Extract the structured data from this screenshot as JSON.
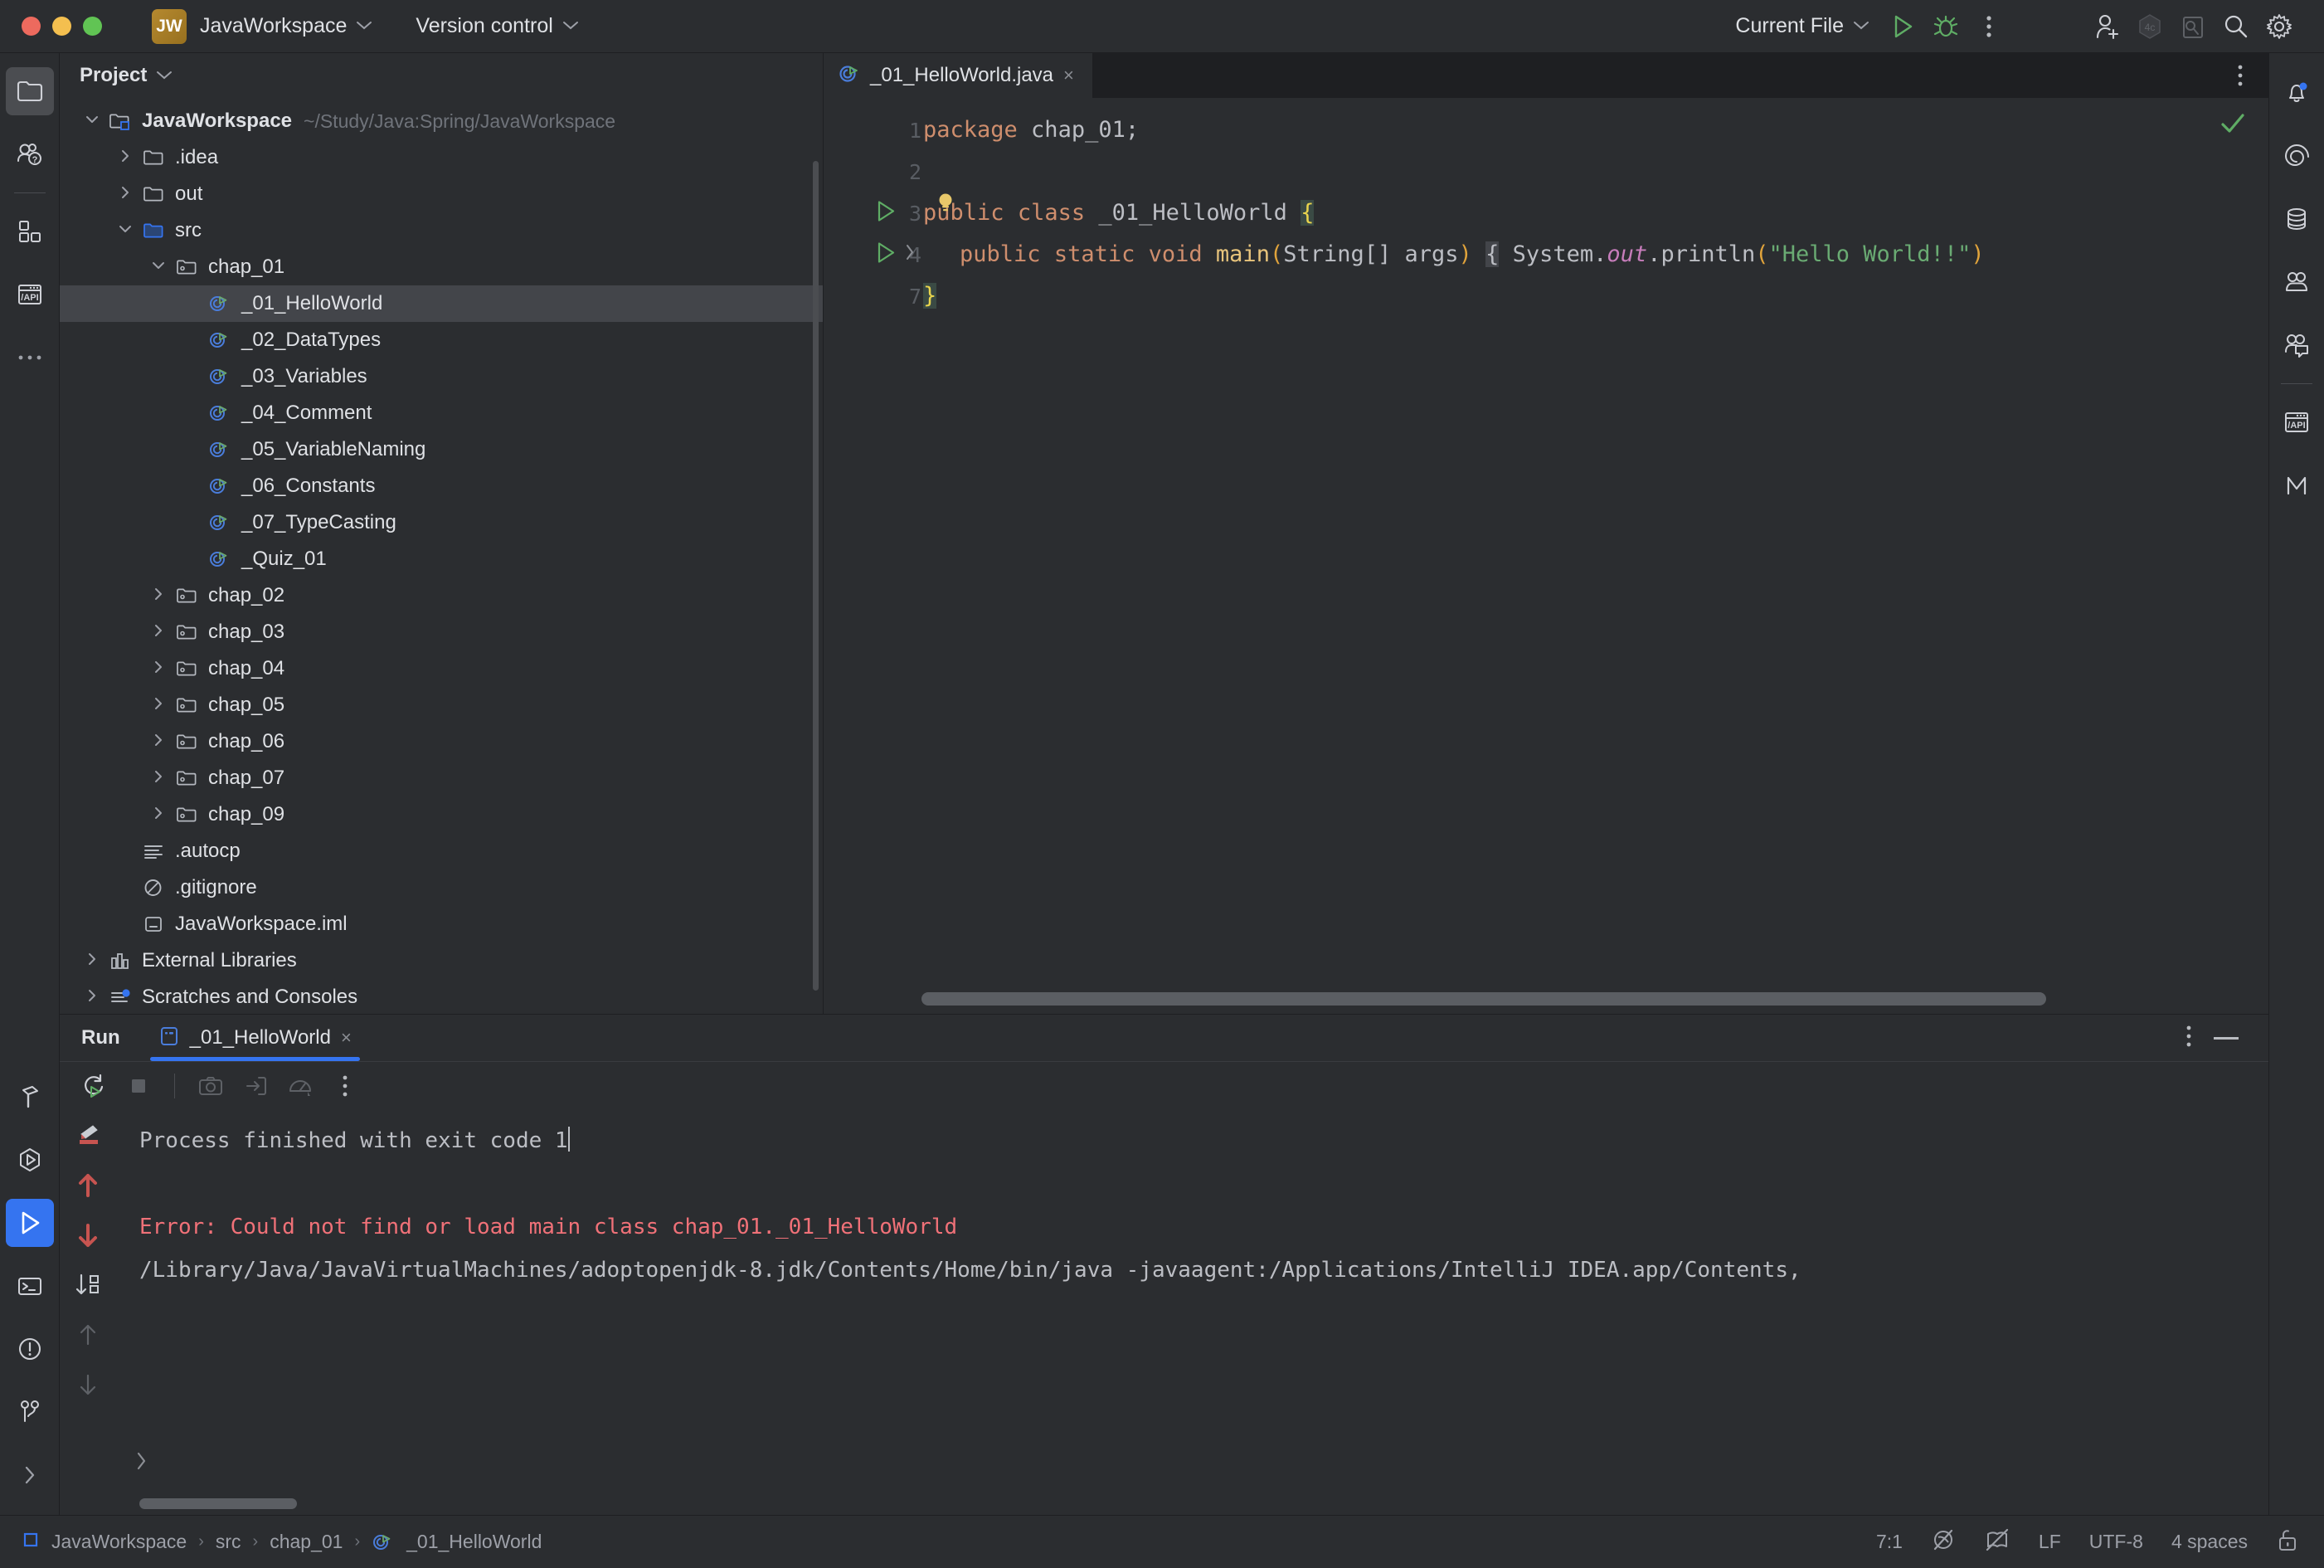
{
  "titlebar": {
    "project_badge": "JW",
    "project_name": "JavaWorkspace",
    "version_control": "Version control",
    "run_config": "Current File",
    "icons": {
      "run": "run-icon",
      "debug": "debug-icon",
      "more": "more-options-icon",
      "add_user": "add-user-icon",
      "code_with_me": "code-with-me-icon",
      "search_everywhere": "search-icon",
      "settings": "settings-icon"
    }
  },
  "left_rail": {
    "top_items": [
      {
        "name": "project-tool-icon",
        "selected": true
      },
      {
        "name": "learn-tool-icon",
        "selected": false
      },
      {
        "name": "plugins-tool-icon",
        "selected": false
      },
      {
        "name": "endpoints-tool-icon",
        "selected": false
      },
      {
        "name": "more-tools-icon",
        "selected": false
      }
    ],
    "bottom_items": [
      {
        "name": "build-tool-icon",
        "selected": false
      },
      {
        "name": "services-tool-icon",
        "selected": false
      },
      {
        "name": "run-tool-icon",
        "selected": true
      },
      {
        "name": "terminal-tool-icon",
        "selected": false
      },
      {
        "name": "problems-tool-icon",
        "selected": false
      },
      {
        "name": "version-control-tool-icon",
        "selected": false
      },
      {
        "name": "expand-rail-icon",
        "selected": false
      }
    ]
  },
  "right_rail": {
    "items": [
      {
        "name": "notifications-icon",
        "badge": true
      },
      {
        "name": "ai-assistant-icon",
        "badge": false
      },
      {
        "name": "database-icon",
        "badge": false
      },
      {
        "name": "code-with-me-icon",
        "badge": false
      },
      {
        "name": "chat-icon",
        "badge": false
      },
      {
        "name": "endpoints-icon",
        "badge": false
      },
      {
        "name": "maven-icon",
        "badge": false
      }
    ]
  },
  "project_panel": {
    "title": "Project",
    "tree": [
      {
        "depth": 0,
        "twisty": "down",
        "icon": "module-folder-icon",
        "label": "JavaWorkspace",
        "bold": true,
        "path": "~/Study/Java:Spring/JavaWorkspace",
        "selected": false
      },
      {
        "depth": 1,
        "twisty": "right",
        "icon": "folder-icon",
        "label": ".idea",
        "bold": false,
        "path": "",
        "selected": false
      },
      {
        "depth": 1,
        "twisty": "right",
        "icon": "folder-icon",
        "label": "out",
        "bold": false,
        "path": "",
        "selected": false
      },
      {
        "depth": 1,
        "twisty": "down",
        "icon": "source-folder-icon",
        "label": "src",
        "bold": false,
        "path": "",
        "selected": false
      },
      {
        "depth": 2,
        "twisty": "down",
        "icon": "package-icon",
        "label": "chap_01",
        "bold": false,
        "path": "",
        "selected": false
      },
      {
        "depth": 3,
        "twisty": "none",
        "icon": "java-class-run-icon",
        "label": "_01_HelloWorld",
        "bold": false,
        "path": "",
        "selected": true
      },
      {
        "depth": 3,
        "twisty": "none",
        "icon": "java-class-run-icon",
        "label": "_02_DataTypes",
        "bold": false,
        "path": "",
        "selected": false
      },
      {
        "depth": 3,
        "twisty": "none",
        "icon": "java-class-run-icon",
        "label": "_03_Variables",
        "bold": false,
        "path": "",
        "selected": false
      },
      {
        "depth": 3,
        "twisty": "none",
        "icon": "java-class-run-icon",
        "label": "_04_Comment",
        "bold": false,
        "path": "",
        "selected": false
      },
      {
        "depth": 3,
        "twisty": "none",
        "icon": "java-class-run-icon",
        "label": "_05_VariableNaming",
        "bold": false,
        "path": "",
        "selected": false
      },
      {
        "depth": 3,
        "twisty": "none",
        "icon": "java-class-run-icon",
        "label": "_06_Constants",
        "bold": false,
        "path": "",
        "selected": false
      },
      {
        "depth": 3,
        "twisty": "none",
        "icon": "java-class-run-icon",
        "label": "_07_TypeCasting",
        "bold": false,
        "path": "",
        "selected": false
      },
      {
        "depth": 3,
        "twisty": "none",
        "icon": "java-class-run-icon",
        "label": "_Quiz_01",
        "bold": false,
        "path": "",
        "selected": false
      },
      {
        "depth": 2,
        "twisty": "right",
        "icon": "package-icon",
        "label": "chap_02",
        "bold": false,
        "path": "",
        "selected": false
      },
      {
        "depth": 2,
        "twisty": "right",
        "icon": "package-icon",
        "label": "chap_03",
        "bold": false,
        "path": "",
        "selected": false
      },
      {
        "depth": 2,
        "twisty": "right",
        "icon": "package-icon",
        "label": "chap_04",
        "bold": false,
        "path": "",
        "selected": false
      },
      {
        "depth": 2,
        "twisty": "right",
        "icon": "package-icon",
        "label": "chap_05",
        "bold": false,
        "path": "",
        "selected": false
      },
      {
        "depth": 2,
        "twisty": "right",
        "icon": "package-icon",
        "label": "chap_06",
        "bold": false,
        "path": "",
        "selected": false
      },
      {
        "depth": 2,
        "twisty": "right",
        "icon": "package-icon",
        "label": "chap_07",
        "bold": false,
        "path": "",
        "selected": false
      },
      {
        "depth": 2,
        "twisty": "right",
        "icon": "package-icon",
        "label": "chap_09",
        "bold": false,
        "path": "",
        "selected": false
      },
      {
        "depth": 1,
        "twisty": "none",
        "icon": "text-file-icon",
        "label": ".autocp",
        "bold": false,
        "path": "",
        "selected": false
      },
      {
        "depth": 1,
        "twisty": "none",
        "icon": "gitignore-icon",
        "label": ".gitignore",
        "bold": false,
        "path": "",
        "selected": false
      },
      {
        "depth": 1,
        "twisty": "none",
        "icon": "iml-file-icon",
        "label": "JavaWorkspace.iml",
        "bold": false,
        "path": "",
        "selected": false
      },
      {
        "depth": 0,
        "twisty": "right",
        "icon": "external-libraries-icon",
        "label": "External Libraries",
        "bold": false,
        "path": "",
        "selected": false
      },
      {
        "depth": 0,
        "twisty": "right",
        "icon": "scratches-icon",
        "label": "Scratches and Consoles",
        "bold": false,
        "path": "",
        "selected": false
      }
    ]
  },
  "editor": {
    "tab": {
      "label": "_01_HelloWorld.java",
      "close": "×",
      "icon": "java-class-run-icon"
    },
    "inspection_status": "ok",
    "lines": [
      {
        "num": "1",
        "run_marker": false,
        "fold": false
      },
      {
        "num": "2",
        "run_marker": false,
        "fold": false
      },
      {
        "num": "3",
        "run_marker": true,
        "fold": false
      },
      {
        "num": "4",
        "run_marker": true,
        "fold": true
      },
      {
        "num": "7",
        "run_marker": false,
        "fold": false
      }
    ],
    "code": {
      "l1_kw": "package",
      "l1_rest": " chap_01;",
      "l3_kw1": "public",
      "l3_kw2": "class",
      "l3_name": "_01_HelloWorld",
      "l3_brace": "{",
      "l4_kw1": "public",
      "l4_kw2": "static",
      "l4_kw3": "void",
      "l4_method": "main",
      "l4_paren_open": "(",
      "l4_params": "String[] args",
      "l4_paren_close": ")",
      "l4_brace_open": "{",
      "l4_sys": "System.",
      "l4_out": "out",
      "l4_println": ".println",
      "l4_p2": "(",
      "l4_string": "\"Hello World!!\"",
      "l4_p3": ")",
      "l7_brace": "}"
    }
  },
  "run_panel": {
    "title": "Run",
    "tab_label": "_01_HelloWorld",
    "tab_close": "×",
    "toolbar_icons": [
      "rerun-icon",
      "stop-icon",
      "screenshot-icon",
      "export-icon",
      "profiler-icon",
      "more-options-icon"
    ],
    "gutter_icons": [
      "soft-wrap-icon",
      "previous-occurrence-icon",
      "next-occurrence-icon",
      "scroll-to-end-icon",
      "up-arrow-icon",
      "down-arrow-icon"
    ],
    "header_icons": [
      "more-options-icon",
      "minimize-icon"
    ],
    "console": [
      {
        "text": "/Library/Java/JavaVirtualMachines/adoptopenjdk-8.jdk/Contents/Home/bin/java -javaagent:/Applications/IntelliJ IDEA.app/Contents,",
        "type": "gray"
      },
      {
        "text": "Error: Could not find or load main class chap_01._01_HelloWorld",
        "type": "error"
      },
      {
        "text": "",
        "type": "gray"
      },
      {
        "text": "Process finished with exit code 1",
        "type": "gray",
        "caret": true
      }
    ]
  },
  "statusbar": {
    "breadcrumb": [
      "JavaWorkspace",
      "src",
      "chap_01",
      "_01_HelloWorld"
    ],
    "separator": "›",
    "caret_position": "7:1",
    "line_separator": "LF",
    "encoding": "UTF-8",
    "indent": "4 spaces",
    "icons": [
      "inspections-off-icon",
      "reader-mode-icon",
      "lock-icon"
    ]
  },
  "colors": {
    "accent_blue": "#3574f0",
    "error_red": "#f07178",
    "keyword_orange": "#cf8e6d",
    "string_green": "#6aab73",
    "panel_bg": "#2b2d30",
    "window_bg": "#1e1f22"
  }
}
